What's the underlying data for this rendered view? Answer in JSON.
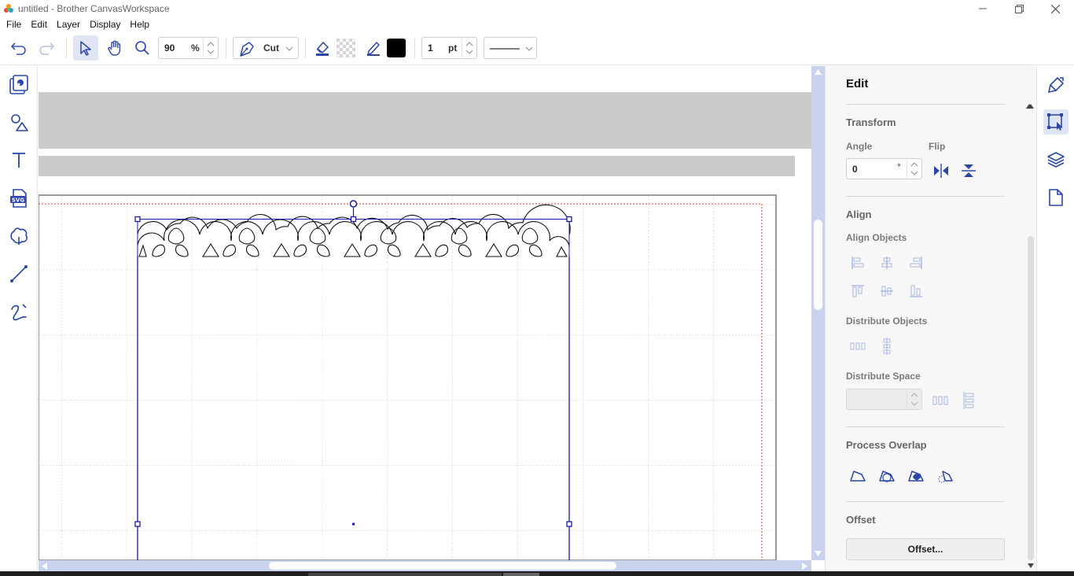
{
  "window": {
    "title": "untitled - Brother CanvasWorkspace"
  },
  "menu": [
    "File",
    "Edit",
    "Layer",
    "Display",
    "Help"
  ],
  "toolbar": {
    "zoom_value": "90",
    "zoom_unit": "%",
    "mode_label": "Cut",
    "line_width_value": "1",
    "line_width_unit": "pt",
    "stroke_color": "#000000"
  },
  "left_tools": [
    "artwork-icon",
    "shapes-icon",
    "text-icon",
    "svg-icon",
    "bucket-icon",
    "line-icon",
    "freehand-icon"
  ],
  "panel": {
    "title": "Edit",
    "transform": {
      "heading": "Transform",
      "angle_label": "Angle",
      "angle_value": "0",
      "angle_unit": "°",
      "flip_label": "Flip"
    },
    "align": {
      "heading": "Align",
      "align_objects_label": "Align Objects",
      "distribute_objects_label": "Distribute Objects",
      "distribute_space_label": "Distribute Space"
    },
    "process_overlap": {
      "heading": "Process Overlap"
    },
    "offset": {
      "heading": "Offset",
      "button_label": "Offset..."
    }
  },
  "right_tools": [
    "paint-icon",
    "edit-transform-icon",
    "layers-icon",
    "page-icon"
  ],
  "colors": {
    "accent": "#1a1aa8",
    "scroll_track": "#c9d3ee",
    "cut_border": "#d04a3a",
    "active_tab": "#e0e5f5"
  }
}
